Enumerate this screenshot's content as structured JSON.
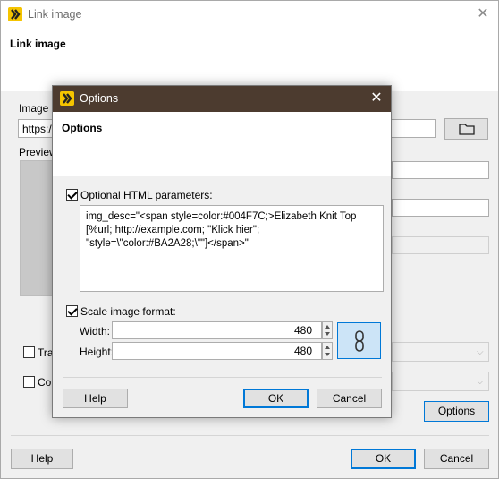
{
  "outer_window": {
    "title": "Link image",
    "heading": "Link image",
    "image_source_label": "Image s",
    "url_value": "https:/",
    "preview_label": "Preview",
    "transparency_label": "Tra",
    "count_label": "Cou",
    "options_button": "Options",
    "help_button": "Help",
    "ok_button": "OK",
    "cancel_button": "Cancel"
  },
  "options_dialog": {
    "title": "Options",
    "heading": "Options",
    "html_params_label": "Optional HTML parameters:",
    "html_params_checked": true,
    "html_params_value": "img_desc=\"<span style=color:#004F7C;>Elizabeth Knit Top [%url; http://example.com; \"Klick hier\"; \"style=\\\"color:#BA2A28;\\\"\"]</span>\"",
    "scale_label": "Scale image format:",
    "scale_checked": true,
    "width_label": "Width:",
    "width_value": "480",
    "height_label": "Height:",
    "height_value": "480",
    "help_button": "Help",
    "ok_button": "OK",
    "cancel_button": "Cancel"
  },
  "colors": {
    "modal_titlebar": "#4c3b2f",
    "logo": "#f5c400",
    "accent": "#0078d7"
  },
  "icons": {
    "folder": "folder-icon",
    "link": "chain-link-icon",
    "close": "close-icon"
  }
}
